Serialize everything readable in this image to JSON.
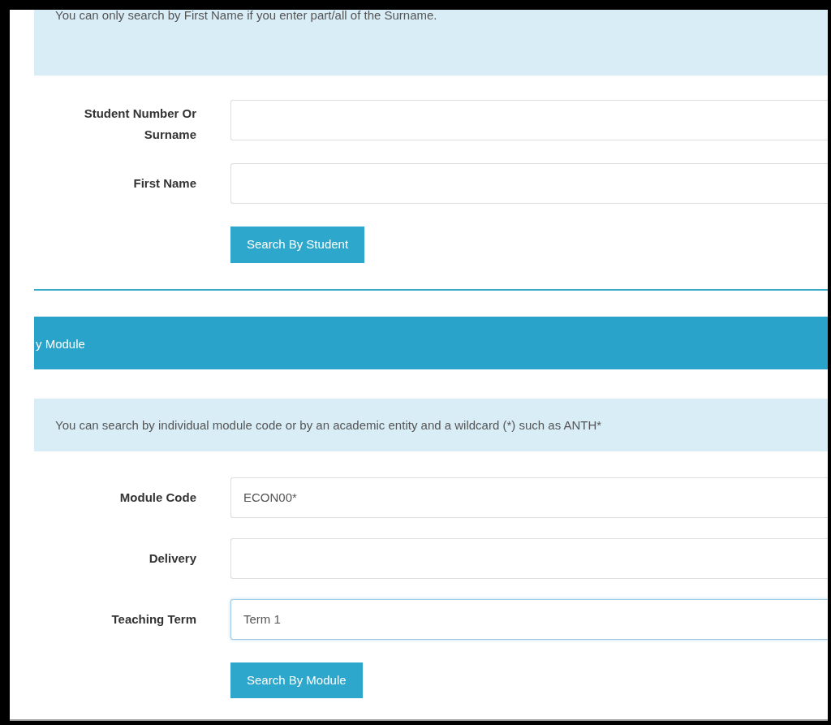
{
  "student_section": {
    "info": "You can only search by First Name if you enter part/all of the Surname.",
    "fields": [
      {
        "label": "Student Number Or Surname",
        "focused": false
      },
      {
        "label": "First Name",
        "focused": false
      }
    ],
    "button": "Search By Student"
  },
  "module_section": {
    "header": "y Module",
    "info": "You can search by individual module code or by an academic entity and a wildcard (*) such as ANTH*",
    "fields": [
      {
        "label": "Module Code",
        "value": "ECON00*",
        "focused": false
      },
      {
        "label": "Delivery",
        "focused": false
      },
      {
        "label": "Teaching Term",
        "value": "Term 1",
        "focused": true
      }
    ],
    "button": "Search By Module"
  }
}
